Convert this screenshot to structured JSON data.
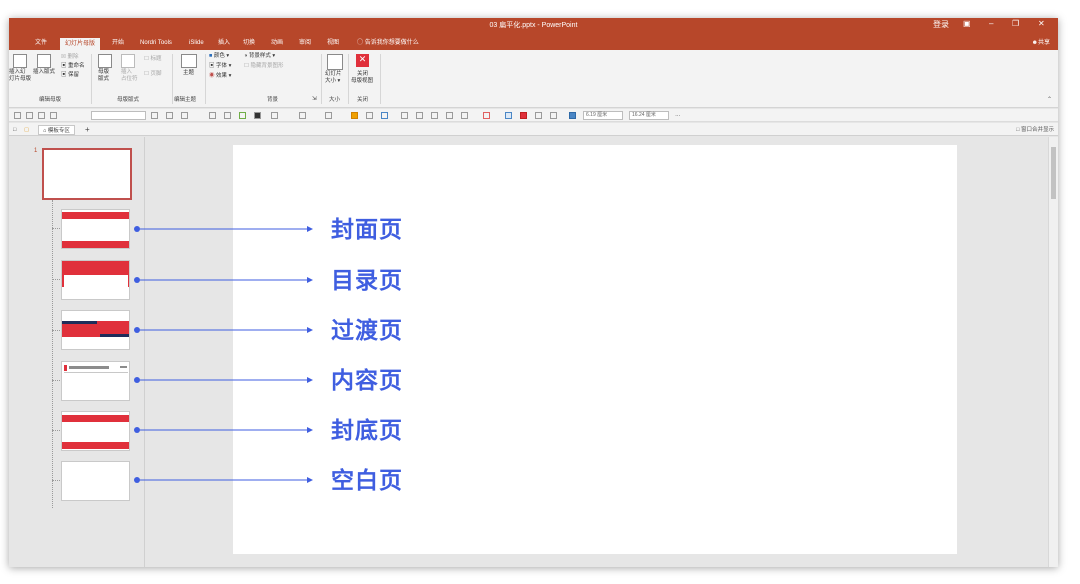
{
  "window": {
    "title": "03 扁平化.pptx  -  PowerPoint",
    "login": "登录",
    "share": "共享"
  },
  "tabs": [
    "文件",
    "幻灯片母版",
    "开始",
    "Nordri Tools",
    "iSlide",
    "插入",
    "切换",
    "动画",
    "审阅",
    "视图"
  ],
  "tell_me": "告诉我你想要做什么",
  "ribbon": {
    "edit_master": {
      "insert_slide_master": [
        "插入幻",
        "灯片母版"
      ],
      "insert_layout": "插入版式",
      "delete": "删除",
      "rename": "重命名",
      "preserve": "保留",
      "group_label": "编辑母版"
    },
    "master_layout": {
      "master_layout_btn": [
        "母版",
        "版式"
      ],
      "insert_placeholder": [
        "插入",
        "占位符"
      ],
      "title_check": "标题",
      "footer_check": "页脚",
      "group_label": "母版版式"
    },
    "edit_theme": {
      "themes": "主题",
      "group_label": "编辑主题"
    },
    "background": {
      "colors": "颜色",
      "fonts": "字体",
      "effects": "效果",
      "bg_styles": "背景样式",
      "hide_bg": "隐藏背景图形",
      "group_label": "背景"
    },
    "size": {
      "slide_size": [
        "幻灯片",
        "大小"
      ],
      "group_label": "大小"
    },
    "close": {
      "close_master": [
        "关闭",
        "母版视图"
      ],
      "group_label": "关闭"
    }
  },
  "quickbar": {
    "width": "6.19 厘米",
    "height": "16.24 厘米"
  },
  "filetabs": {
    "template_zone": "模板专区",
    "add": "+",
    "merge_windows": "窗口合并显示"
  },
  "thumbnail_pane": {
    "master_number": "1"
  },
  "annotations": [
    "封面页",
    "目录页",
    "过渡页",
    "内容页",
    "封底页",
    "空白页"
  ],
  "colors": {
    "title_bar": "#b7472a",
    "annotation": "#3f5ee0",
    "slide_red": "#e0303b"
  }
}
